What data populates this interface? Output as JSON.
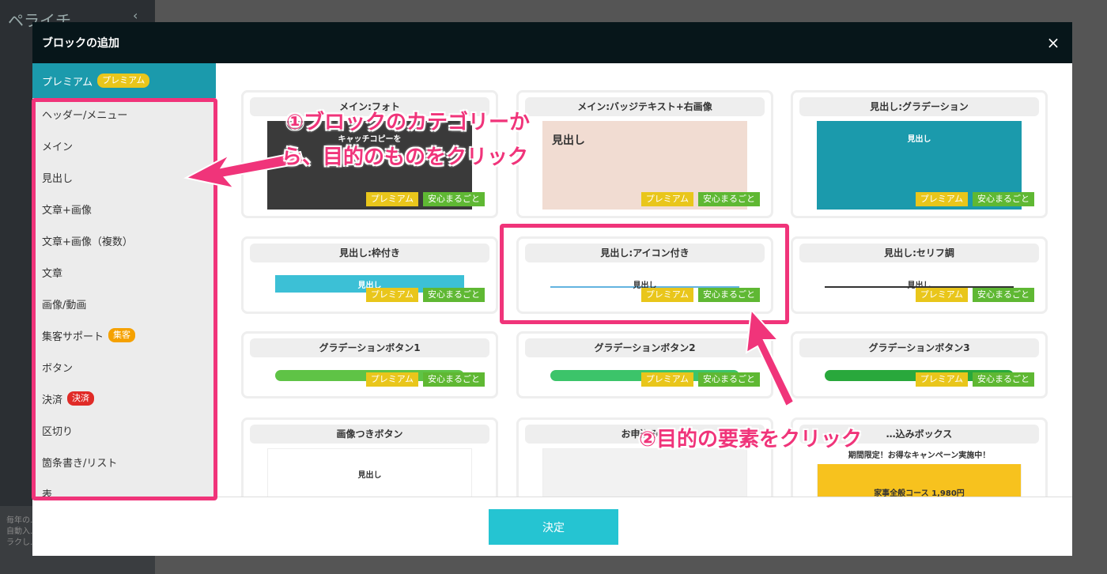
{
  "background": {
    "app_logo": "ペライチ",
    "footer_text": "毎年の…\n自動入…\nラクし…"
  },
  "modal": {
    "title": "ブロックの追加",
    "close_label": "×",
    "confirm_label": "決定"
  },
  "sidebar": {
    "items": [
      {
        "label": "プレミアム",
        "badge": "プレミアム",
        "badge_type": "premium",
        "active": true
      },
      {
        "label": "ヘッダー/メニュー"
      },
      {
        "label": "メイン"
      },
      {
        "label": "見出し"
      },
      {
        "label": "文章+画像"
      },
      {
        "label": "文章+画像（複数）"
      },
      {
        "label": "文章"
      },
      {
        "label": "画像/動画"
      },
      {
        "label": "集客サポート",
        "badge": "集客",
        "badge_type": "collect"
      },
      {
        "label": "ボタン"
      },
      {
        "label": "決済",
        "badge": "決済",
        "badge_type": "pay"
      },
      {
        "label": "区切り"
      },
      {
        "label": "箇条書き/リスト"
      },
      {
        "label": "表"
      }
    ]
  },
  "tags": {
    "premium": "プレミアム",
    "safe": "安心まるごと"
  },
  "cards": [
    {
      "title": "メイン:フォト",
      "preview_text": "キャッチコピーを",
      "preview_color": "#3a3a3a"
    },
    {
      "title": "メイン:バッジテキスト+右画像",
      "preview_text": "見出し",
      "preview_color": "#f1dcd2"
    },
    {
      "title": "見出し:グラデーション",
      "preview_text": "見出し",
      "preview_color": "#1b9aac"
    },
    {
      "title": "見出し:枠付き",
      "preview_text": "見出し",
      "preview_color": "#3cc0d6"
    },
    {
      "title": "見出し:アイコン付き",
      "preview_text": "見出し",
      "preview_color": "#63b4e0"
    },
    {
      "title": "見出し:セリフ調",
      "preview_text": "見出し",
      "preview_color": "#333333"
    },
    {
      "title": "グラデーションボタン1",
      "preview_text": "",
      "preview_color": "#5fc346"
    },
    {
      "title": "グラデーションボタン2",
      "preview_text": "",
      "preview_color": "#3cc46a"
    },
    {
      "title": "グラデーションボタン3",
      "preview_text": "",
      "preview_color": "#29a83c"
    },
    {
      "title": "画像つきボタン",
      "preview_text": "見出し",
      "preview_color": "#ffffff"
    },
    {
      "title": "お申込み…",
      "preview_text": "",
      "preview_color": "#f2f2f2"
    },
    {
      "title": "…込みボックス",
      "preview_text": "家事全般コース 1,980円",
      "banner": "期間限定！お得なキャンペーン実施中！",
      "preview_color": "#f7c21e"
    }
  ],
  "annotations": {
    "step1_line1": "①ブロックのカテゴリーか",
    "step1_line2": "ら、目的のものをクリック",
    "step2": "②目的の要素をクリック"
  },
  "colors": {
    "accent": "#1b9aac",
    "annotation": "#f0347a",
    "confirm": "#25c4d2",
    "premium_tag": "#e9c61b",
    "safe_tag": "#5fb833"
  }
}
